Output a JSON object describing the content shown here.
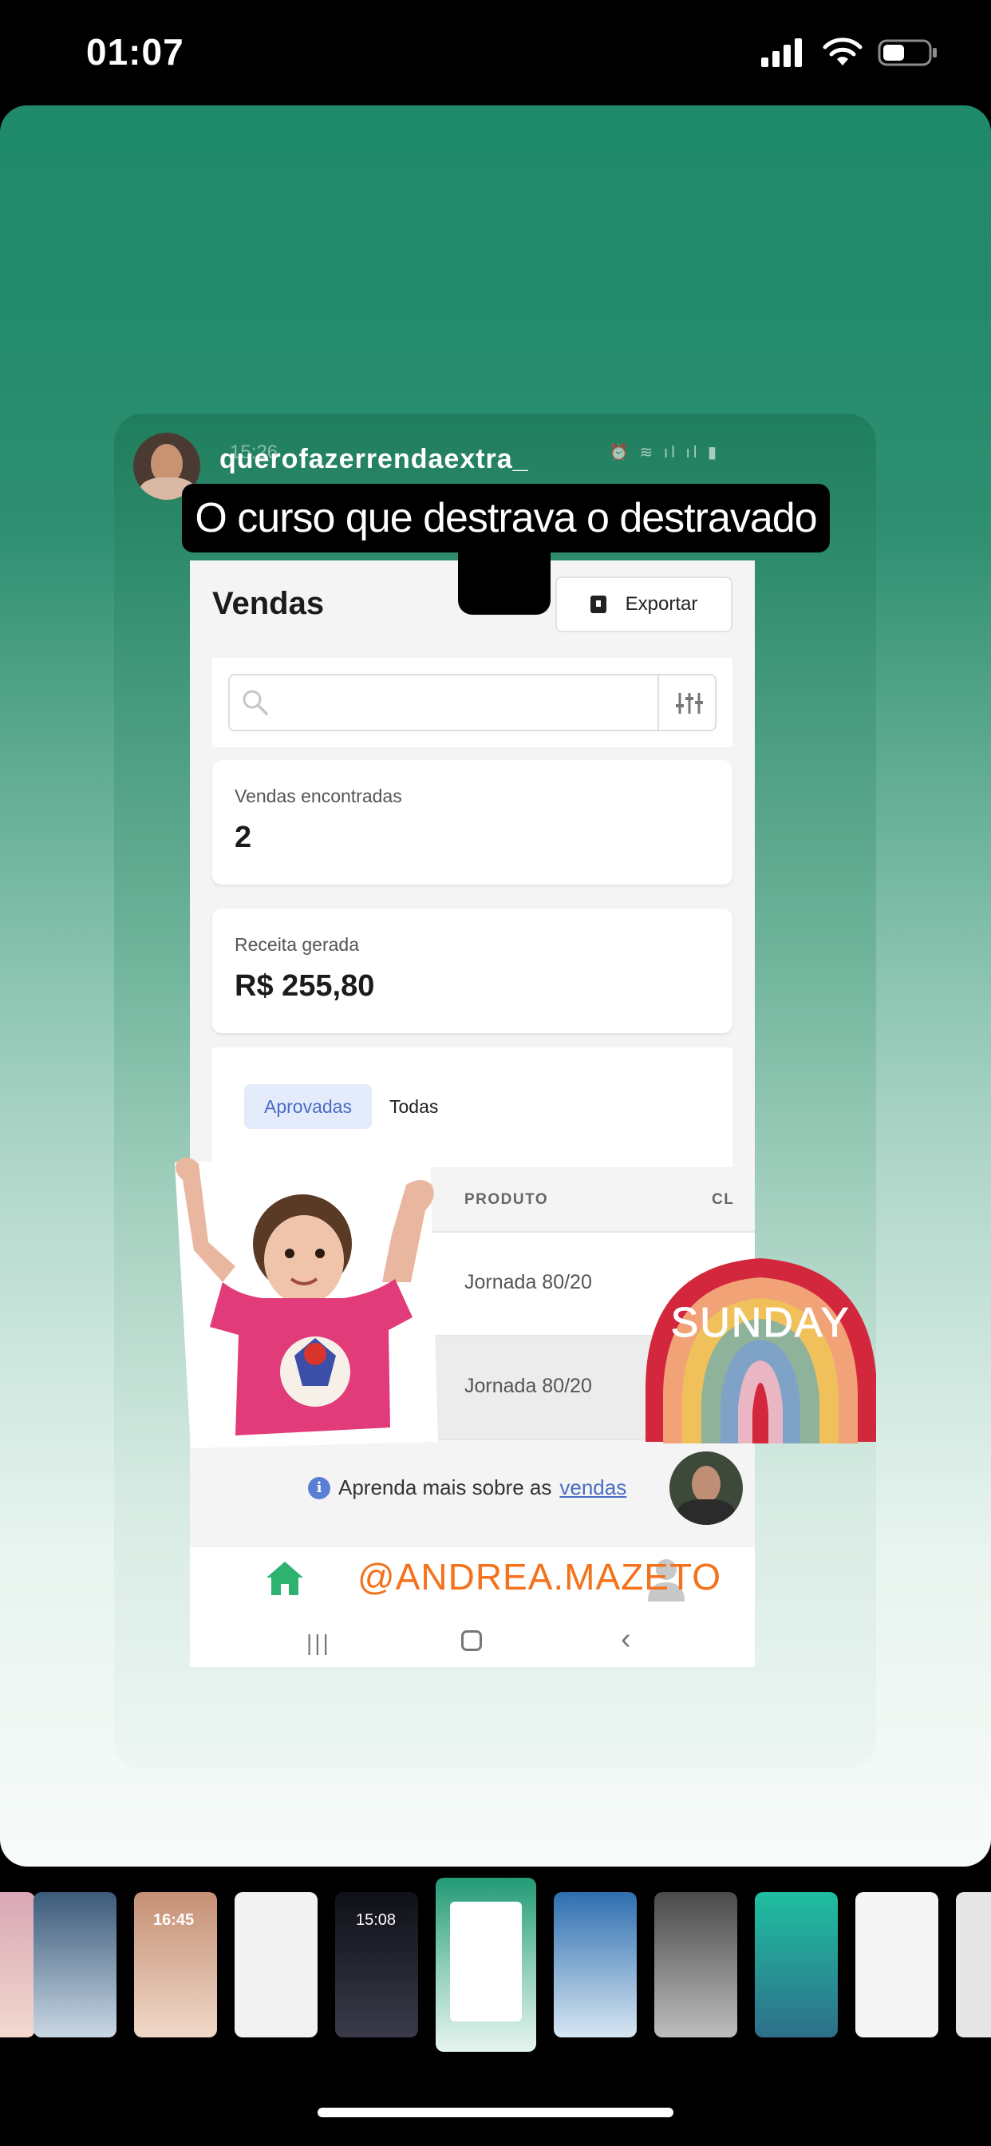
{
  "status_bar": {
    "time": "01:07"
  },
  "story": {
    "username": "querofazerrendaextra_",
    "ghost_time": "15:26",
    "caption": "O curso que destrava o destravado",
    "emoji": "😅",
    "mention": "@ANDREA.MAZETO",
    "sticker_text": "SUNDAY"
  },
  "app": {
    "page_title": "Vendas",
    "export_label": "Exportar",
    "search": {
      "placeholder": ""
    },
    "stats": [
      {
        "label": "Vendas encontradas",
        "value": "2"
      },
      {
        "label": "Receita gerada",
        "value": "R$ 255,80"
      }
    ],
    "tabs": [
      {
        "label": "Aprovadas",
        "active": true
      },
      {
        "label": "Todas",
        "active": false
      }
    ],
    "table": {
      "columns": [
        "PRODUTO",
        "CL"
      ],
      "rows": [
        {
          "produto": "Jornada 80/20"
        },
        {
          "produto": "Jornada 80/20"
        }
      ]
    },
    "info": {
      "text": "Aprenda mais sobre as ",
      "link": "vendas"
    }
  },
  "thumbnails": {
    "thumb_times": [
      "16:45",
      "15:08"
    ]
  },
  "colors": {
    "accent_blue": "#4a6cc3",
    "brand_green": "#2db36f",
    "mention_orange": "#f4721b"
  }
}
